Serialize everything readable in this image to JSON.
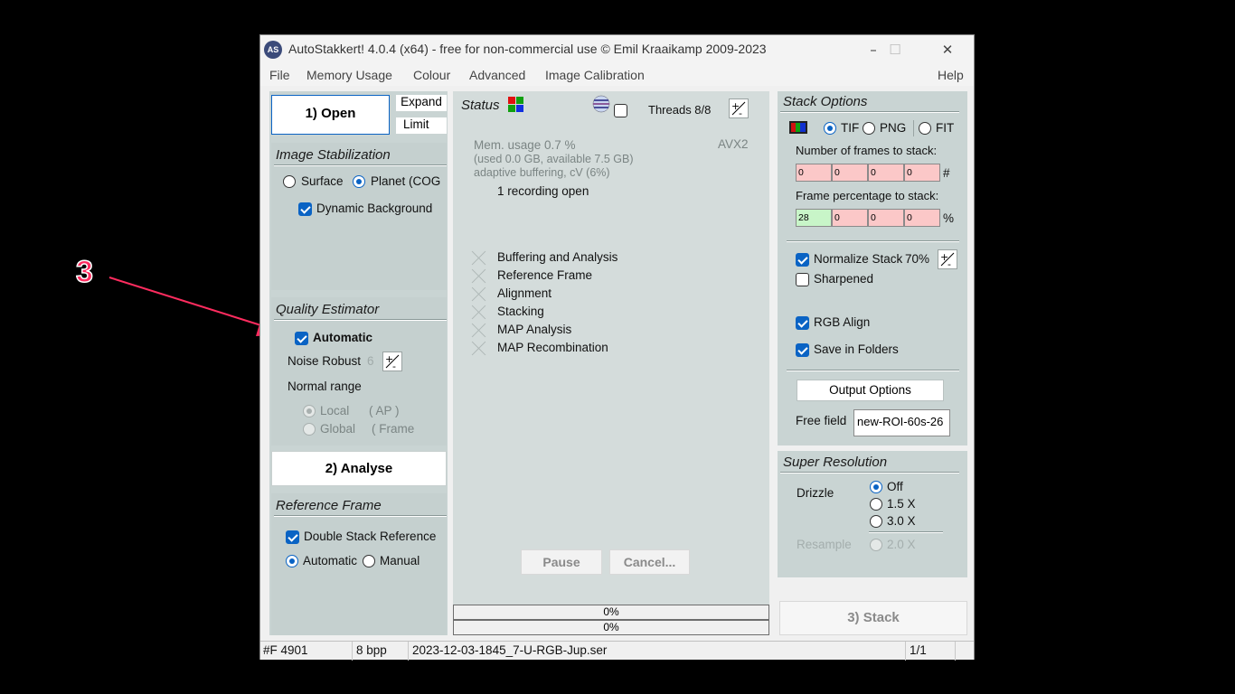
{
  "annotation": {
    "number": "3",
    "color": "#ff2c5f"
  },
  "window": {
    "title": "AutoStakkert! 4.0.4 (x64) - free for non-commercial use © Emil Kraaikamp 2009-2023",
    "minimize_icon": "–",
    "maximize_icon": "☐",
    "close_icon": "✕"
  },
  "menu": {
    "file": "File",
    "memory_usage": "Memory Usage",
    "colour": "Colour",
    "advanced": "Advanced",
    "image_calibration": "Image Calibration",
    "help": "Help"
  },
  "left": {
    "open_button": "1) Open",
    "expand_button": "Expand",
    "limit_button": "Limit",
    "image_stabilization": {
      "title": "Image Stabilization",
      "surface": "Surface",
      "planet": "Planet (COG",
      "mode_selected": "planet",
      "dynamic_background": "Dynamic Background",
      "dynamic_background_checked": true
    },
    "quality_estimator": {
      "title": "Quality Estimator",
      "automatic": "Automatic",
      "automatic_checked": true,
      "noise_robust": "Noise Robust",
      "noise_robust_value": "6",
      "normal_range": "Normal range",
      "local": "Local",
      "local_suffix": "( AP )",
      "global": "Global",
      "global_suffix": "( Frame"
    },
    "analyse_button": "2) Analyse",
    "reference_frame": {
      "title": "Reference Frame",
      "double_stack": "Double Stack Reference",
      "double_stack_checked": true,
      "automatic": "Automatic",
      "manual": "Manual",
      "selected": "automatic"
    }
  },
  "center": {
    "status_title": "Status",
    "threads": "Threads 8/8",
    "avx": "AVX2",
    "mem_usage": "Mem. usage 0.7 %",
    "mem_detail": "(used 0.0 GB, available 7.5 GB)",
    "buffering": "adaptive buffering, cV (6%)",
    "recording": "1 recording open",
    "steps": [
      "Buffering and Analysis",
      "Reference Frame",
      "Alignment",
      "Stacking",
      "MAP Analysis",
      "MAP Recombination"
    ],
    "pause_button": "Pause",
    "cancel_button": "Cancel...",
    "progress1": {
      "label": "0%",
      "value": 0
    },
    "progress2": {
      "label": "0%",
      "value": 0
    }
  },
  "right": {
    "stack_options": {
      "title": "Stack Options",
      "formats": [
        "TIF",
        "PNG",
        "FIT"
      ],
      "format_selected": "TIF",
      "frames_label": "Number of frames to stack:",
      "frames_values": [
        "0",
        "0",
        "0",
        "0"
      ],
      "frames_unit": "#",
      "percent_label": "Frame percentage to stack:",
      "percent_values": [
        "28",
        "0",
        "0",
        "0"
      ],
      "percent_unit": "%",
      "normalize": "Normalize Stack",
      "normalize_value": "70%",
      "normalize_checked": true,
      "sharpened": "Sharpened",
      "sharpened_checked": false,
      "rgb_align": "RGB Align",
      "rgb_align_checked": true,
      "save_folders": "Save in Folders",
      "save_folders_checked": true,
      "output_options": "Output Options",
      "free_field_label": "Free field",
      "free_field_value": "new-ROI-60s-26"
    },
    "super_resolution": {
      "title": "Super Resolution",
      "drizzle": "Drizzle",
      "options": [
        "Off",
        "1.5 X",
        "3.0 X"
      ],
      "selected": "Off",
      "resample": "Resample",
      "resample_option": "2.0 X"
    },
    "stack_button": "3) Stack"
  },
  "statusbar": {
    "frames": "#F 4901",
    "bpp": "8 bpp",
    "file": "2023-12-03-1845_7-U-RGB-Jup.ser",
    "page": "1/1"
  }
}
